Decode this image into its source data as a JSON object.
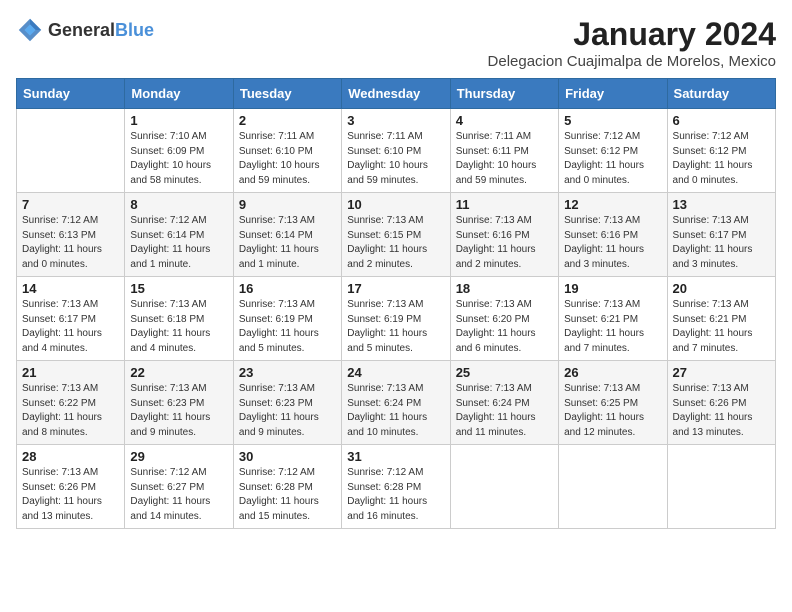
{
  "header": {
    "logo": {
      "general": "General",
      "blue": "Blue"
    },
    "title": "January 2024",
    "location": "Delegacion Cuajimalpa de Morelos, Mexico"
  },
  "days_of_week": [
    "Sunday",
    "Monday",
    "Tuesday",
    "Wednesday",
    "Thursday",
    "Friday",
    "Saturday"
  ],
  "weeks": [
    [
      {
        "day": "",
        "info": ""
      },
      {
        "day": "1",
        "info": "Sunrise: 7:10 AM\nSunset: 6:09 PM\nDaylight: 10 hours\nand 58 minutes."
      },
      {
        "day": "2",
        "info": "Sunrise: 7:11 AM\nSunset: 6:10 PM\nDaylight: 10 hours\nand 59 minutes."
      },
      {
        "day": "3",
        "info": "Sunrise: 7:11 AM\nSunset: 6:10 PM\nDaylight: 10 hours\nand 59 minutes."
      },
      {
        "day": "4",
        "info": "Sunrise: 7:11 AM\nSunset: 6:11 PM\nDaylight: 10 hours\nand 59 minutes."
      },
      {
        "day": "5",
        "info": "Sunrise: 7:12 AM\nSunset: 6:12 PM\nDaylight: 11 hours\nand 0 minutes."
      },
      {
        "day": "6",
        "info": "Sunrise: 7:12 AM\nSunset: 6:12 PM\nDaylight: 11 hours\nand 0 minutes."
      }
    ],
    [
      {
        "day": "7",
        "info": "Sunrise: 7:12 AM\nSunset: 6:13 PM\nDaylight: 11 hours\nand 0 minutes."
      },
      {
        "day": "8",
        "info": "Sunrise: 7:12 AM\nSunset: 6:14 PM\nDaylight: 11 hours\nand 1 minute."
      },
      {
        "day": "9",
        "info": "Sunrise: 7:13 AM\nSunset: 6:14 PM\nDaylight: 11 hours\nand 1 minute."
      },
      {
        "day": "10",
        "info": "Sunrise: 7:13 AM\nSunset: 6:15 PM\nDaylight: 11 hours\nand 2 minutes."
      },
      {
        "day": "11",
        "info": "Sunrise: 7:13 AM\nSunset: 6:16 PM\nDaylight: 11 hours\nand 2 minutes."
      },
      {
        "day": "12",
        "info": "Sunrise: 7:13 AM\nSunset: 6:16 PM\nDaylight: 11 hours\nand 3 minutes."
      },
      {
        "day": "13",
        "info": "Sunrise: 7:13 AM\nSunset: 6:17 PM\nDaylight: 11 hours\nand 3 minutes."
      }
    ],
    [
      {
        "day": "14",
        "info": "Sunrise: 7:13 AM\nSunset: 6:17 PM\nDaylight: 11 hours\nand 4 minutes."
      },
      {
        "day": "15",
        "info": "Sunrise: 7:13 AM\nSunset: 6:18 PM\nDaylight: 11 hours\nand 4 minutes."
      },
      {
        "day": "16",
        "info": "Sunrise: 7:13 AM\nSunset: 6:19 PM\nDaylight: 11 hours\nand 5 minutes."
      },
      {
        "day": "17",
        "info": "Sunrise: 7:13 AM\nSunset: 6:19 PM\nDaylight: 11 hours\nand 5 minutes."
      },
      {
        "day": "18",
        "info": "Sunrise: 7:13 AM\nSunset: 6:20 PM\nDaylight: 11 hours\nand 6 minutes."
      },
      {
        "day": "19",
        "info": "Sunrise: 7:13 AM\nSunset: 6:21 PM\nDaylight: 11 hours\nand 7 minutes."
      },
      {
        "day": "20",
        "info": "Sunrise: 7:13 AM\nSunset: 6:21 PM\nDaylight: 11 hours\nand 7 minutes."
      }
    ],
    [
      {
        "day": "21",
        "info": "Sunrise: 7:13 AM\nSunset: 6:22 PM\nDaylight: 11 hours\nand 8 minutes."
      },
      {
        "day": "22",
        "info": "Sunrise: 7:13 AM\nSunset: 6:23 PM\nDaylight: 11 hours\nand 9 minutes."
      },
      {
        "day": "23",
        "info": "Sunrise: 7:13 AM\nSunset: 6:23 PM\nDaylight: 11 hours\nand 9 minutes."
      },
      {
        "day": "24",
        "info": "Sunrise: 7:13 AM\nSunset: 6:24 PM\nDaylight: 11 hours\nand 10 minutes."
      },
      {
        "day": "25",
        "info": "Sunrise: 7:13 AM\nSunset: 6:24 PM\nDaylight: 11 hours\nand 11 minutes."
      },
      {
        "day": "26",
        "info": "Sunrise: 7:13 AM\nSunset: 6:25 PM\nDaylight: 11 hours\nand 12 minutes."
      },
      {
        "day": "27",
        "info": "Sunrise: 7:13 AM\nSunset: 6:26 PM\nDaylight: 11 hours\nand 13 minutes."
      }
    ],
    [
      {
        "day": "28",
        "info": "Sunrise: 7:13 AM\nSunset: 6:26 PM\nDaylight: 11 hours\nand 13 minutes."
      },
      {
        "day": "29",
        "info": "Sunrise: 7:12 AM\nSunset: 6:27 PM\nDaylight: 11 hours\nand 14 minutes."
      },
      {
        "day": "30",
        "info": "Sunrise: 7:12 AM\nSunset: 6:28 PM\nDaylight: 11 hours\nand 15 minutes."
      },
      {
        "day": "31",
        "info": "Sunrise: 7:12 AM\nSunset: 6:28 PM\nDaylight: 11 hours\nand 16 minutes."
      },
      {
        "day": "",
        "info": ""
      },
      {
        "day": "",
        "info": ""
      },
      {
        "day": "",
        "info": ""
      }
    ]
  ]
}
